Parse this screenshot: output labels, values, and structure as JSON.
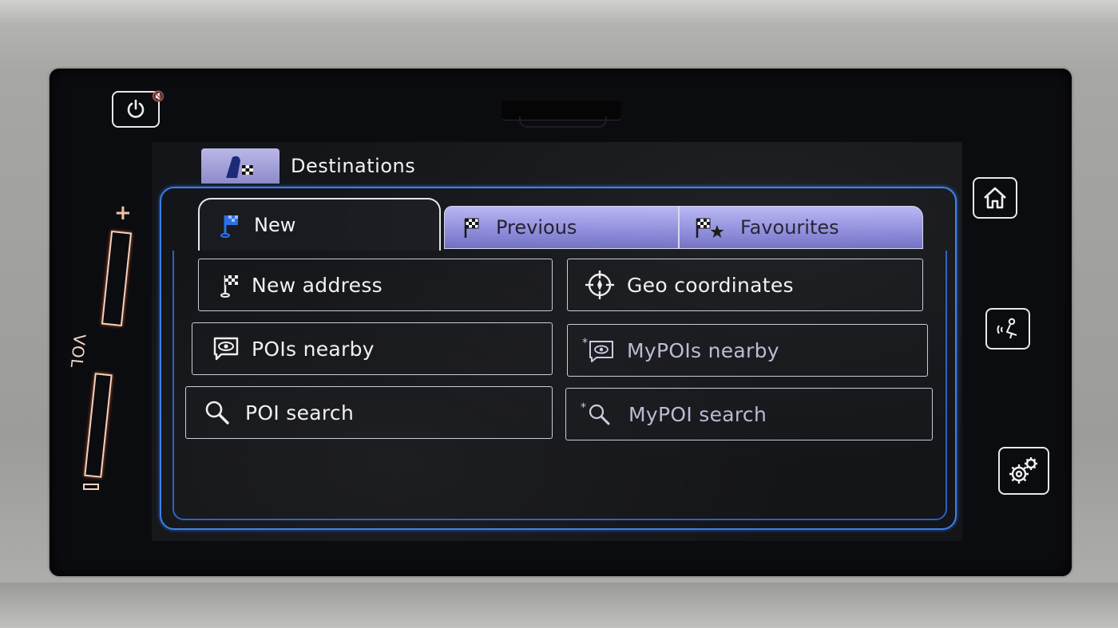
{
  "header": {
    "title": "Destinations",
    "icon": "destination-flag-icon"
  },
  "tabs": [
    {
      "label": "New",
      "icon": "blue-flag-icon",
      "active": true
    },
    {
      "label": "Previous",
      "icon": "checkered-flag-icon",
      "active": false
    },
    {
      "label": "Favourites",
      "icon": "flag-star-icon",
      "active": false
    }
  ],
  "menu": {
    "new_address": "New address",
    "geo_coordinates": "Geo coordinates",
    "pois_nearby": "POIs nearby",
    "mypois_nearby": "MyPOIs nearby",
    "poi_search": "POI search",
    "mypoi_search": "MyPOI search"
  },
  "hardware": {
    "volume_label": "VOL",
    "volume_plus": "+",
    "buttons": [
      "power-icon",
      "home-icon",
      "voice-icon",
      "settings-icon"
    ]
  },
  "colors": {
    "frame_blue": "#3a7ee8",
    "tab_violet": "#a7a5ea",
    "volume_glow": "#f5d2bf"
  }
}
